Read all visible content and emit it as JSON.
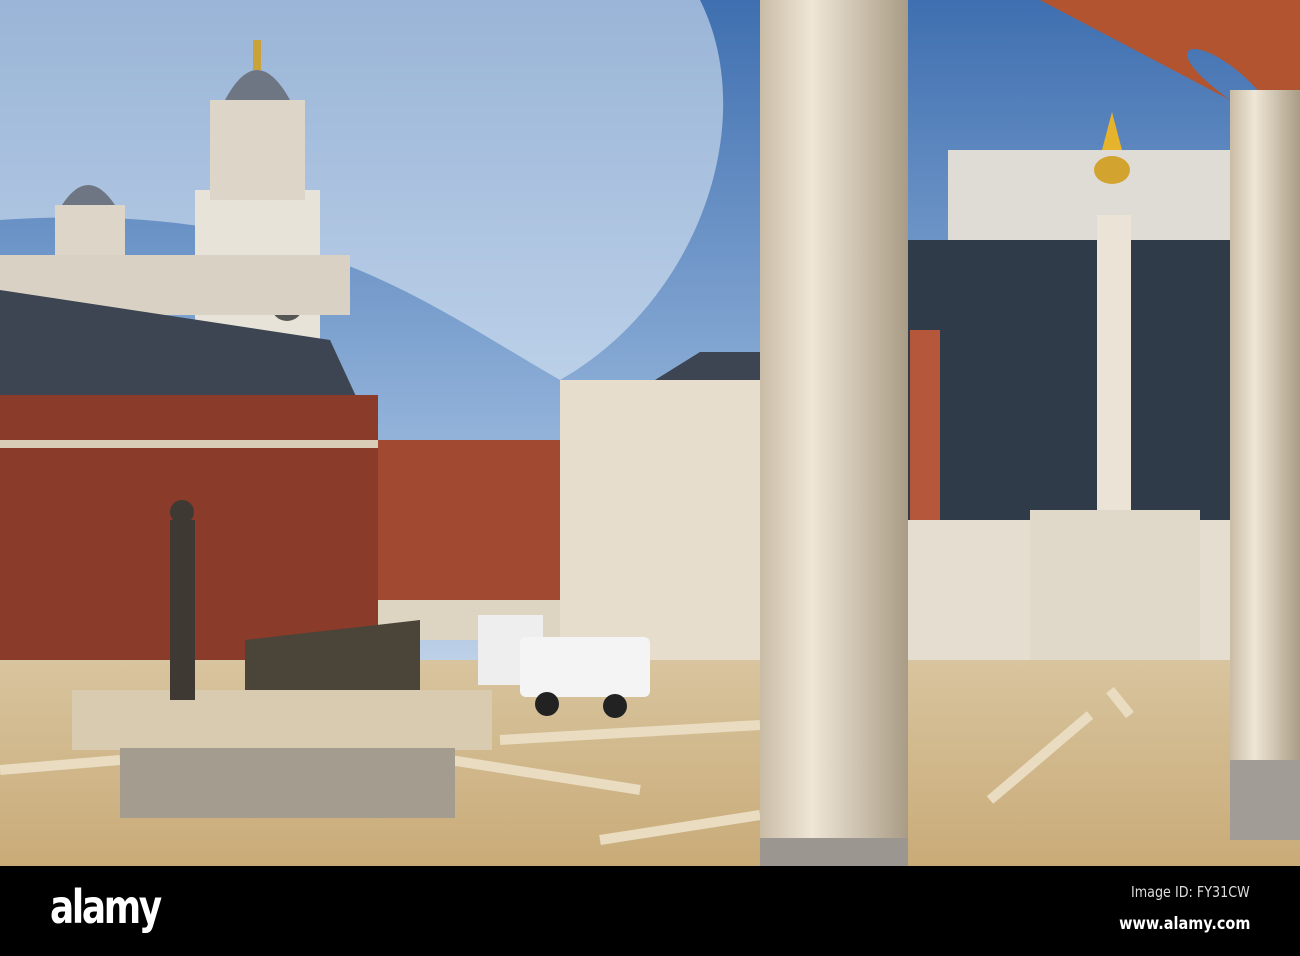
{
  "watermark": {
    "logo": "alamy",
    "image_id": "Image ID: FY31CW",
    "url": "www.alamy.com"
  },
  "colors": {
    "sky_top": "#3f6fb0",
    "sky_bottom": "#b9cde6",
    "brick": "#8a3b2a",
    "stone": "#e6ddcc",
    "plaza": "#d9c39a",
    "column": "#e3d8c6"
  }
}
